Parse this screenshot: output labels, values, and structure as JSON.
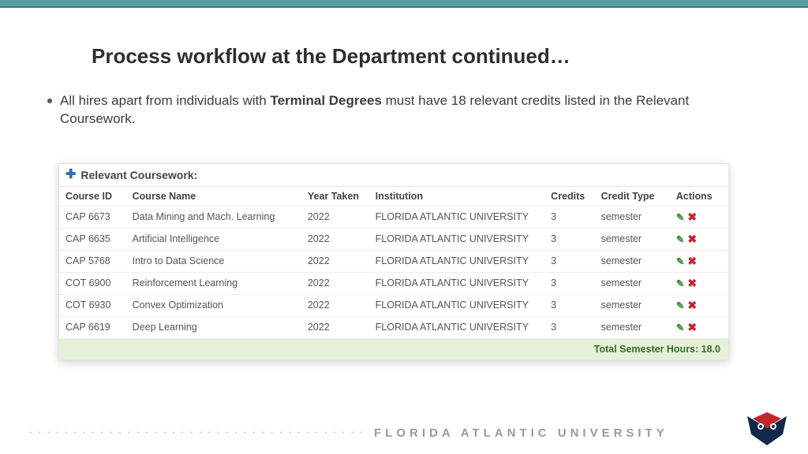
{
  "title": "Process workflow at the Department continued…",
  "bullet": {
    "pre": "All hires apart from individuals with ",
    "bold": "Terminal Degrees",
    "post": " must have 18 relevant credits listed in the Relevant Coursework."
  },
  "card": {
    "header": "Relevant Coursework:",
    "columns": {
      "id": "Course ID",
      "name": "Course Name",
      "year": "Year Taken",
      "inst": "Institution",
      "cred": "Credits",
      "ctype": "Credit Type",
      "act": "Actions"
    },
    "rows": [
      {
        "id": "CAP 6673",
        "name": "Data Mining and Mach. Learning",
        "year": "2022",
        "inst": "FLORIDA ATLANTIC UNIVERSITY",
        "cred": "3",
        "ctype": "semester"
      },
      {
        "id": "CAP 6635",
        "name": "Artificial Intelligence",
        "year": "2022",
        "inst": "FLORIDA ATLANTIC UNIVERSITY",
        "cred": "3",
        "ctype": "semester"
      },
      {
        "id": "CAP 5768",
        "name": "Intro to Data Science",
        "year": "2022",
        "inst": "FLORIDA ATLANTIC UNIVERSITY",
        "cred": "3",
        "ctype": "semester"
      },
      {
        "id": "COT 6900",
        "name": "Reinforcement Learning",
        "year": "2022",
        "inst": "FLORIDA ATLANTIC UNIVERSITY",
        "cred": "3",
        "ctype": "semester"
      },
      {
        "id": "COT 6930",
        "name": "Convex Optimization",
        "year": "2022",
        "inst": "FLORIDA ATLANTIC UNIVERSITY",
        "cred": "3",
        "ctype": "semester"
      },
      {
        "id": "CAP 6619",
        "name": "Deep Learning",
        "year": "2022",
        "inst": "FLORIDA ATLANTIC UNIVERSITY",
        "cred": "3",
        "ctype": "semester"
      }
    ],
    "total_label": "Total Semester Hours: ",
    "total_value": "18.0"
  },
  "footer_university": "FLORIDA ATLANTIC UNIVERSITY"
}
